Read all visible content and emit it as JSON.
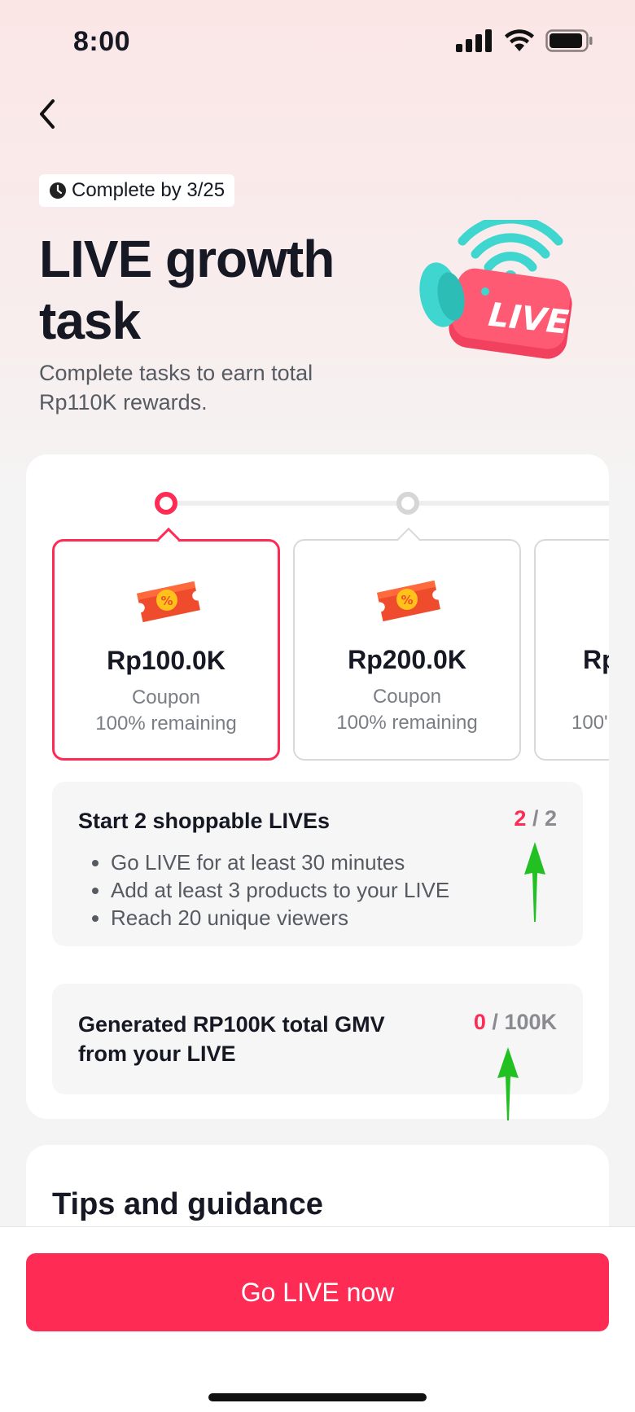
{
  "status_bar": {
    "time": "8:00"
  },
  "header": {
    "deadline": "Complete by 3/25",
    "title": "LIVE growth task",
    "subtitle": "Complete tasks to earn total Rp110K rewards.",
    "illustration_label": "LIVE"
  },
  "rewards": [
    {
      "amount": "Rp100.0K",
      "kind": "Coupon",
      "remaining": "100% remaining",
      "selected": true
    },
    {
      "amount": "Rp200.0K",
      "kind": "Coupon",
      "remaining": "100% remaining",
      "selected": false
    },
    {
      "amount": "Rp",
      "kind": "",
      "remaining": "100'",
      "selected": false
    }
  ],
  "tasks": [
    {
      "title": "Start 2 shoppable LIVEs",
      "done": "2",
      "separator": "/",
      "total": "2",
      "bullets": [
        "Go LIVE for at least 30 minutes",
        "Add at least 3 products to your LIVE",
        "Reach 20 unique viewers"
      ]
    },
    {
      "title": "Generated RP100K total GMV from your LIVE",
      "done": "0",
      "separator": "/",
      "total": "100K"
    }
  ],
  "tips": {
    "title": "Tips and guidance"
  },
  "cta": {
    "label": "Go LIVE now"
  },
  "colors": {
    "accent": "#fe2c55",
    "annotation_arrow": "#22c022"
  }
}
